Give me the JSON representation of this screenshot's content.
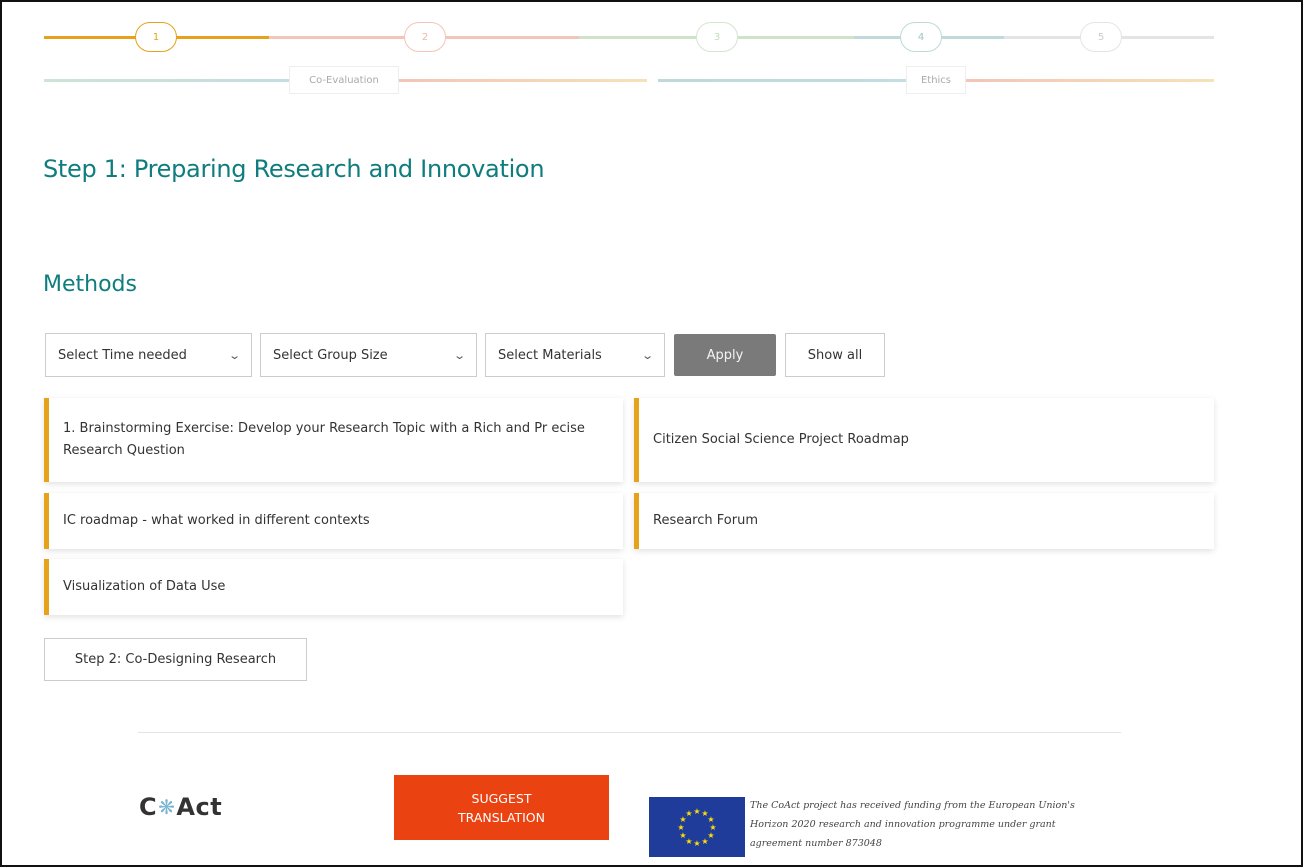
{
  "stepper": {
    "steps": [
      "1",
      "2",
      "3",
      "4",
      "5"
    ],
    "active_step": "1",
    "phases": [
      "Co-Evaluation",
      "Ethics"
    ]
  },
  "page_title": "Step 1: Preparing Research and Innovation",
  "methods": {
    "title": "Methods",
    "filters": {
      "time": "Select Time needed",
      "group": "Select Group Size",
      "materials": "Select Materials"
    },
    "apply_label": "Apply",
    "show_all_label": "Show all",
    "cards": [
      "1. Brainstorming Exercise: Develop your Research Topic with a Rich and Pr ecise Research Question",
      "Citizen Social Science Project Roadmap",
      "IC roadmap - what worked in different contexts",
      "Research Forum",
      "Visualization of Data Use"
    ]
  },
  "next_step_label": "Step 2: Co-Designing Research",
  "footer": {
    "logo_left": "C",
    "logo_right": "Act",
    "suggest_line1": "SUGGEST",
    "suggest_line2": "TRANSLATION",
    "funding_text": "The CoAct project has received funding from the European Union's Horizon 2020 research and innovation programme under grant agreement number 873048"
  },
  "colors": {
    "accent": "#e6a21a",
    "heading": "#0f7d7e",
    "suggest": "#ea4210",
    "eu_blue": "#1f3c9a"
  }
}
